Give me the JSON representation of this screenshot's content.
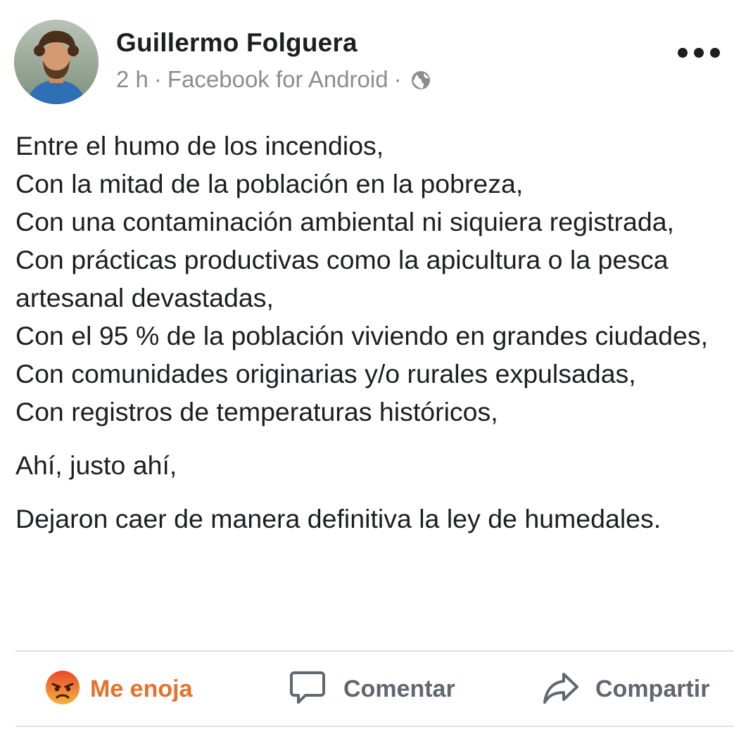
{
  "post": {
    "author": "Guillermo Folguera",
    "time": "2 h",
    "source": "Facebook for Android",
    "separator": "·",
    "audience_icon": "globe-icon",
    "paragraphs": [
      "Entre el humo de los incendios,\nCon la mitad de la población en la pobreza,\nCon una contaminación ambiental ni siquiera registrada,\nCon prácticas productivas como la apicultura o la pesca artesanal devastadas,\nCon el 95 % de la población viviendo en grandes ciudades,\nCon comunidades originarias y/o rurales expulsadas,\nCon registros de temperaturas históricos,",
      "Ahí, justo ahí,",
      "Dejaron caer de manera definitiva la ley de humedales."
    ]
  },
  "actions": {
    "react_label": "Me enoja",
    "react_icon": "angry-emoji-icon",
    "comment_label": "Comentar",
    "comment_icon": "comment-bubble-icon",
    "share_label": "Compartir",
    "share_icon": "share-arrow-icon"
  },
  "colors": {
    "text": "#1c1e21",
    "meta": "#8a8d91",
    "action_gray": "#606770",
    "angry_orange": "#e6712a",
    "divider": "#dfe1e5"
  }
}
